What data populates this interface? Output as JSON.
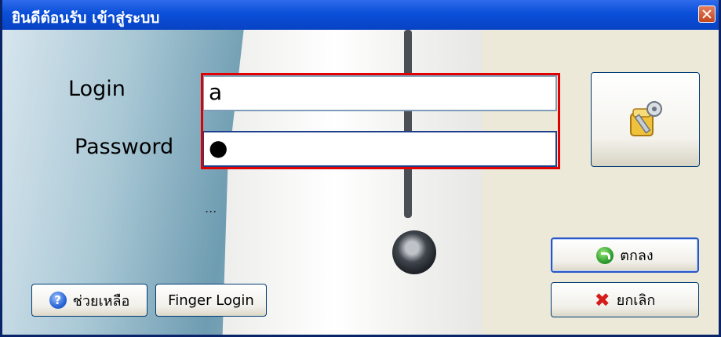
{
  "window": {
    "title": "ยินดีต้อนรับ เข้าสู่ระบบ"
  },
  "form": {
    "login_label": "Login",
    "login_value": "a",
    "password_label": "Password",
    "password_value": "●",
    "status_text": "..."
  },
  "buttons": {
    "ok_label": "ตกลง",
    "cancel_label": "ยกเลิก",
    "help_label": "ช่วยเหลือ",
    "finger_label": "Finger Login"
  },
  "icons": {
    "close": "close-icon",
    "key": "key-icon",
    "ok": "ok-arrow-icon",
    "cancel": "cancel-x-icon",
    "help": "help-icon"
  }
}
